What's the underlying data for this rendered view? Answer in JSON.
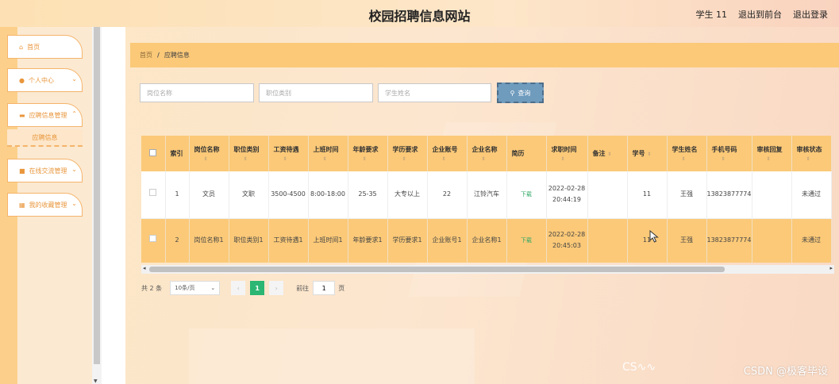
{
  "header": {
    "title": "校园招聘信息网站",
    "user_label": "学生 11",
    "back_to_front": "退出到前台",
    "logout": "退出登录"
  },
  "sidebar": {
    "items": [
      {
        "label": "首页",
        "icon": "home-icon"
      },
      {
        "label": "个人中心",
        "icon": "user-icon"
      },
      {
        "label": "应聘信息管理",
        "icon": "briefcase-icon"
      },
      {
        "label": "在线交流管理",
        "icon": "chat-icon"
      },
      {
        "label": "我的收藏管理",
        "icon": "collection-icon"
      }
    ],
    "subitem": "应聘信息"
  },
  "breadcrumb": {
    "home": "首页",
    "separator": "/",
    "current": "应聘信息"
  },
  "search": {
    "position_placeholder": "岗位名称",
    "category_placeholder": "职位类别",
    "student_placeholder": "学生姓名",
    "button_label": "查询"
  },
  "table": {
    "headers": [
      "索引",
      "岗位名称",
      "职位类别",
      "工资待遇",
      "上班时间",
      "年龄要求",
      "学历要求",
      "企业账号",
      "企业名称",
      "简历",
      "求职时间",
      "备注",
      "学号",
      "学生姓名",
      "手机号码",
      "审核回复",
      "审核状态"
    ],
    "rows": [
      {
        "index": "1",
        "position": "文员",
        "category": "文职",
        "salary": "3500-4500",
        "work_time": "8:00-18:00",
        "age": "25-35",
        "education": "大专以上",
        "company_account": "22",
        "company_name": "江铃汽车",
        "resume": "下载",
        "apply_time": "2022-02-28 20:44:19",
        "remark": "",
        "student_id": "11",
        "student_name": "王强",
        "phone": "13823877774",
        "review_reply": "",
        "review_status": "未通过"
      },
      {
        "index": "2",
        "position": "岗位名称1",
        "category": "职位类别1",
        "salary": "工资待遇1",
        "work_time": "上班时间1",
        "age": "年龄要求1",
        "education": "学历要求1",
        "company_account": "企业账号1",
        "company_name": "企业名称1",
        "resume": "下载",
        "apply_time": "2022-02-28 20:45:03",
        "remark": "",
        "student_id": "11",
        "student_name": "王强",
        "phone": "13823877774",
        "review_reply": "",
        "review_status": "未通过"
      }
    ]
  },
  "pagination": {
    "total": "共 2 条",
    "page_size": "10条/页",
    "prev": "‹",
    "current": "1",
    "next": "›",
    "goto_label": "前往",
    "goto_value": "1",
    "goto_unit": "页"
  },
  "watermark_left": "CS∿∿",
  "watermark": "CSDN @极客毕设"
}
